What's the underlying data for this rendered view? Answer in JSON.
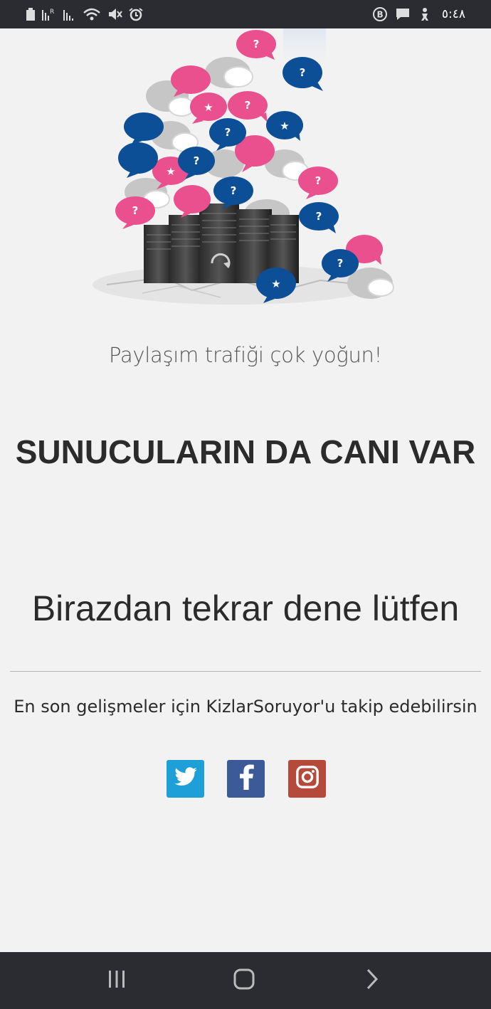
{
  "status_bar": {
    "time": "٥:٤٨",
    "icons": [
      "battery-icon",
      "signal-r-icon",
      "signal-icon",
      "wifi-icon",
      "mute-icon",
      "alarm-icon",
      "b-badge-icon",
      "message-icon",
      "accessibility-icon"
    ]
  },
  "page": {
    "illustration": "servers-speech-bubbles-illustration",
    "tagline": "Paylaşım trafiği çok yoğun!",
    "headline": "SUNUCULARIN DA CANI VAR",
    "subhead": "Birazdan tekrar dene lütfen",
    "follow_text": "En son gelişmeler için KizlarSoruyor'u takip edebilirsin"
  },
  "social": [
    {
      "name": "twitter",
      "icon": "twitter-icon",
      "color": "#1f9fd8"
    },
    {
      "name": "facebook",
      "icon": "facebook-icon",
      "color": "#3c5a98"
    },
    {
      "name": "instagram",
      "icon": "instagram-icon",
      "color": "#b54a3a"
    }
  ],
  "nav": {
    "buttons": [
      "recent-apps-icon",
      "home-icon",
      "back-icon"
    ]
  },
  "colors": {
    "background": "#f2f2f2",
    "bars": "#2b2c31",
    "bubble_pink": "#ea4f8e",
    "bubble_blue": "#0d4f97",
    "bubble_gray": "#c8c8c8"
  }
}
